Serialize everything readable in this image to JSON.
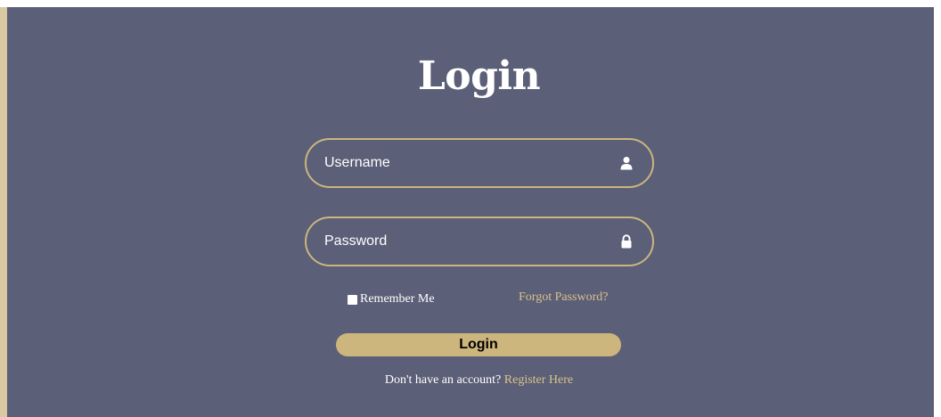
{
  "login_form": {
    "title": "Login",
    "username": {
      "placeholder": "Username",
      "value": "",
      "icon": "user-icon"
    },
    "password": {
      "placeholder": "Password",
      "value": "",
      "icon": "lock-icon"
    },
    "remember_me": {
      "label": "Remember Me",
      "checked": false
    },
    "forgot_password_label": "Forgot Password?",
    "submit_label": "Login",
    "register_prompt": "Don't have an account?",
    "register_link_label": "Register Here"
  },
  "colors": {
    "background": "#5b5f77",
    "accent": "#cdb57e",
    "link": "#d9c28c",
    "left_border": "#d8c9a3",
    "text": "#ffffff"
  }
}
